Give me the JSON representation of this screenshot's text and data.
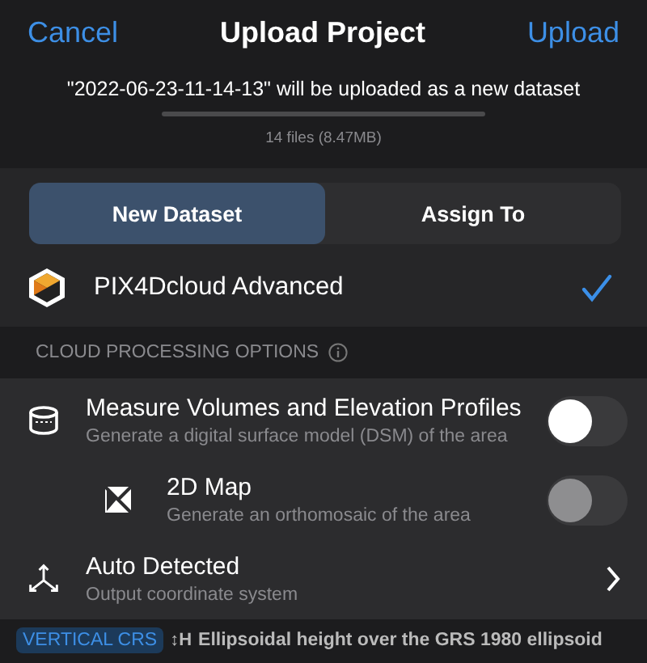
{
  "nav": {
    "cancel": "Cancel",
    "title": "Upload Project",
    "upload": "Upload"
  },
  "info": {
    "message": "\"2022-06-23-11-14-13\" will be uploaded as a new dataset",
    "files": "14 files (8.47MB)"
  },
  "segments": [
    {
      "label": "New Dataset",
      "selected": true
    },
    {
      "label": "Assign To",
      "selected": false
    }
  ],
  "product": {
    "name": "PIX4Dcloud Advanced",
    "checked": true
  },
  "section_header": "CLOUD PROCESSING OPTIONS",
  "options": [
    {
      "kind": "toggle",
      "title": "Measure Volumes and Elevation Profiles",
      "subtitle": "Generate a digital surface model (DSM) of the area",
      "on": false,
      "disabled": false
    },
    {
      "kind": "subtoggle",
      "title": "2D Map",
      "subtitle": "Generate an orthomosaic of the area",
      "on": false,
      "disabled": true
    },
    {
      "kind": "link",
      "title": "Auto Detected",
      "subtitle": "Output coordinate system"
    }
  ],
  "footer": {
    "tag": "VERTICAL CRS",
    "symbol": "↕H",
    "text": "Ellipsoidal height over the GRS 1980 ellipsoid"
  }
}
